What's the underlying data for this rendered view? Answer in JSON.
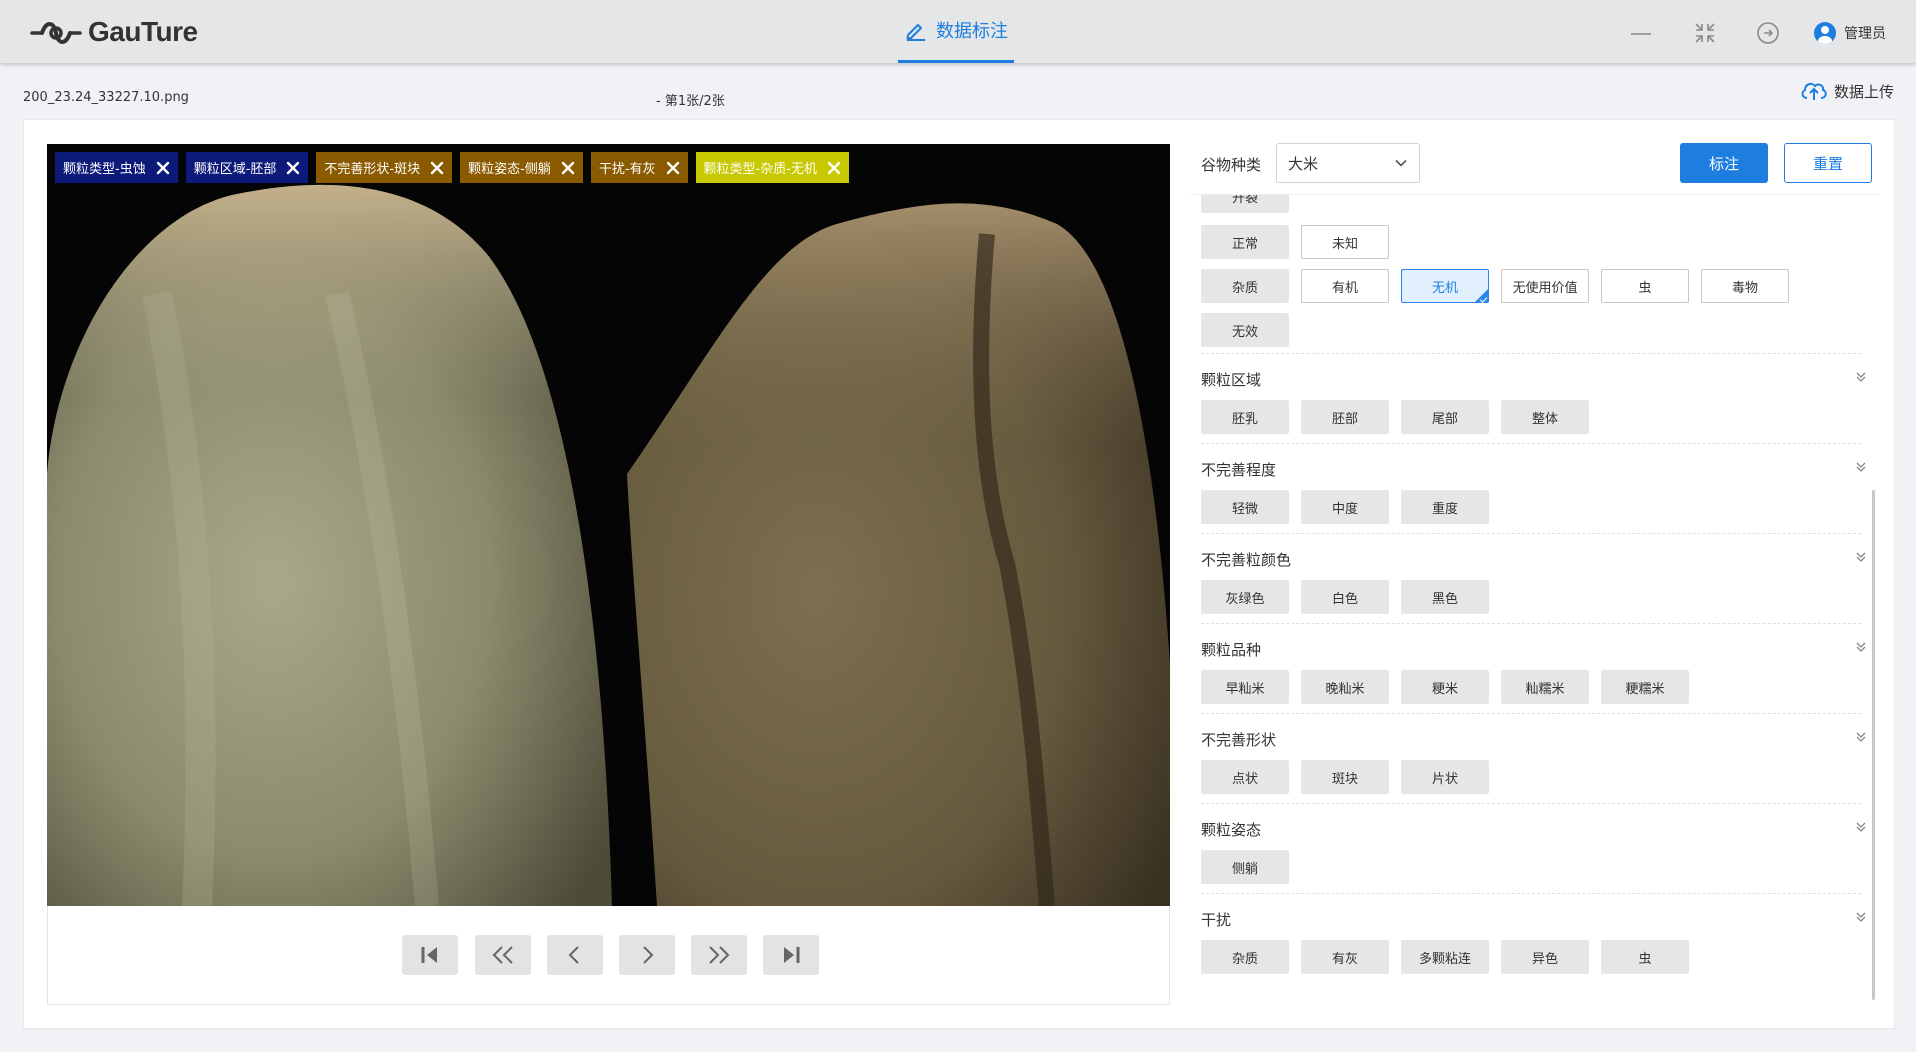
{
  "header": {
    "logo_text": "GauTure",
    "nav_tab_label": "数据标注",
    "user_name": "管理员"
  },
  "file_bar": {
    "filename": "200_23.24_33227.10.png",
    "page_info": "- 第1张/2张",
    "upload_label": "数据上传"
  },
  "image_tags": [
    {
      "label": "颗粒类型-虫蚀",
      "color": "#0c1a7a"
    },
    {
      "label": "颗粒区域-胚部",
      "color": "#0c1a7a"
    },
    {
      "label": "不完善形状-斑块",
      "color": "#8a5a00"
    },
    {
      "label": "颗粒姿态-侧躺",
      "color": "#8a5a00"
    },
    {
      "label": "干扰-有灰",
      "color": "#8a5a00"
    },
    {
      "label": "颗粒类型-杂质-无机",
      "color": "#c8c800"
    }
  ],
  "controls": {
    "grain_label": "谷物种类",
    "grain_value": "大米",
    "mark_button": "标注",
    "reset_button": "重置"
  },
  "top_rows": {
    "partial_label": "开裂",
    "row1": [
      "正常",
      "未知"
    ],
    "row2": [
      "杂质",
      "有机",
      "无机",
      "无使用价值",
      "虫",
      "毒物"
    ],
    "row3": [
      "无效"
    ],
    "selected": "无机"
  },
  "sections": [
    {
      "title": "颗粒区域",
      "options": [
        "胚乳",
        "胚部",
        "尾部",
        "整体"
      ]
    },
    {
      "title": "不完善程度",
      "options": [
        "轻微",
        "中度",
        "重度"
      ]
    },
    {
      "title": "不完善粒颜色",
      "options": [
        "灰绿色",
        "白色",
        "黑色"
      ]
    },
    {
      "title": "颗粒品种",
      "options": [
        "早籼米",
        "晚籼米",
        "粳米",
        "籼糯米",
        "粳糯米"
      ]
    },
    {
      "title": "不完善形状",
      "options": [
        "点状",
        "斑块",
        "片状"
      ]
    },
    {
      "title": "颗粒姿态",
      "options": [
        "侧躺"
      ]
    },
    {
      "title": "干扰",
      "options": [
        "杂质",
        "有灰",
        "多颗粘连",
        "异色",
        "虫"
      ]
    }
  ],
  "navigation": {
    "buttons": [
      "first-page",
      "prev-fast",
      "prev",
      "next",
      "next-fast",
      "last-page"
    ]
  },
  "colors": {
    "accent": "#1e7ee0",
    "topbar_bg": "#e5e6e8",
    "panel_bg": "#ffffff",
    "option_bg": "#e6e6e6"
  }
}
